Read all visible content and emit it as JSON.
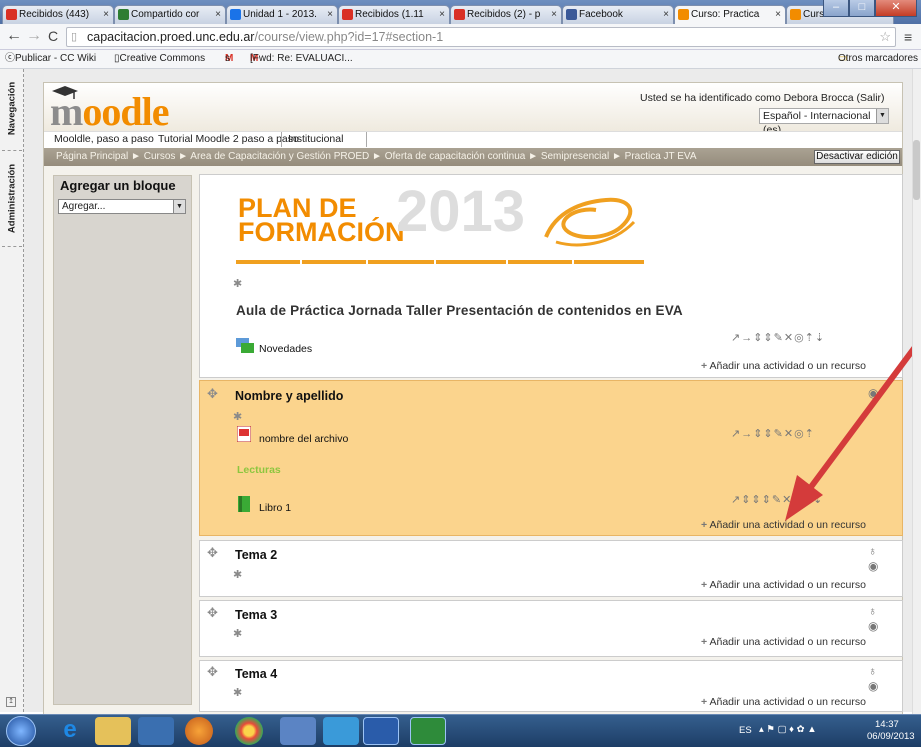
{
  "browser": {
    "tabs": [
      {
        "label": "Recibidos (443)",
        "color": "#d93025"
      },
      {
        "label": "Compartido cor",
        "color": "#2e7d32"
      },
      {
        "label": "Unidad 1 - 2013.",
        "color": "#1a73e8"
      },
      {
        "label": "Recibidos (1.11",
        "color": "#d93025"
      },
      {
        "label": "Recibidos (2) - p",
        "color": "#d93025"
      },
      {
        "label": "Facebook",
        "color": "#3b5998"
      },
      {
        "label": "Curso: Practica",
        "color": "#f28c00"
      },
      {
        "label": "Curso: Prácticas",
        "color": "#f28c00"
      }
    ],
    "url_host": "capacitacion.proed.unc.edu.ar",
    "url_path": "/course/view.php?id=17#section-1",
    "bookmarks": {
      "items": [
        "Publicar - CC Wiki",
        "Creative Commons",
        "s",
        "[Fwd: Re: EVALUACI..."
      ],
      "other": "Otros marcadores"
    }
  },
  "dock": {
    "nav": "Navegación",
    "admin": "Administración"
  },
  "moodle": {
    "logo": "moodle",
    "login_info": "Usted se ha identificado como Debora Brocca (Salir)",
    "language": "Español - Internacional (es)",
    "menu": [
      "Mooldle, paso a paso",
      "Tutorial Moodle 2 paso a paso",
      "Institucional"
    ],
    "breadcrumb": "Página Principal ► Cursos ► Area de Capacitación y Gestión PROED ► Oferta de capacitación continua ► Semipresencial ► Practica JT EVA",
    "edit_button": "Desactivar edición",
    "block_title": "Agregar un bloque",
    "block_select": "Agregar...",
    "banner": {
      "line1": "PLAN DE",
      "line2": "FORMACIÓN",
      "year": "2013"
    },
    "course_title": "Aula de Práctica Jornada Taller Presentación de contenidos en EVA",
    "news": "Novedades",
    "add_activity": "Añadir una actividad o un recurso",
    "section1": {
      "title": "Nombre y apellido",
      "file": "nombre del archivo",
      "label": "Lecturas",
      "book": "Libro 1"
    },
    "sections": [
      "Tema 2",
      "Tema 3",
      "Tema 4"
    ]
  },
  "taskbar": {
    "lang": "ES",
    "time": "14:37",
    "date": "06/09/2013"
  },
  "colors": {
    "highlight_section": "#fbd48d",
    "lecturas": "#8dc63f",
    "arrow": "#d43b3b"
  }
}
